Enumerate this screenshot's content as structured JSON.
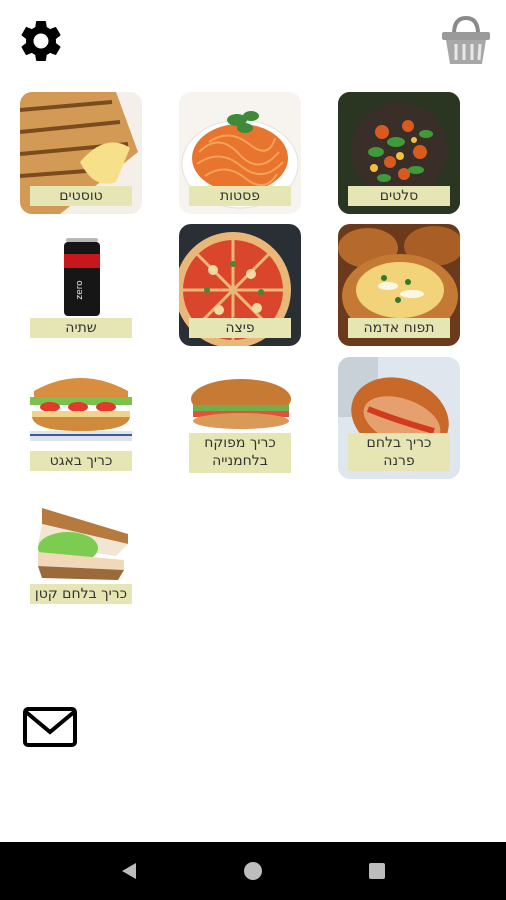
{
  "colors": {
    "label_bg": "#e6e6b4",
    "nav_bg": "#000000",
    "icon": "#000000"
  },
  "icons": {
    "settings": "gear-icon",
    "cart": "shopping-basket-icon",
    "mail": "mail-icon"
  },
  "categories": [
    {
      "id": "salads",
      "label": "סלטים"
    },
    {
      "id": "pastas",
      "label": "פסטות"
    },
    {
      "id": "toasts",
      "label": "טוסטים"
    },
    {
      "id": "potato",
      "label": "תפוח אדמה"
    },
    {
      "id": "pizza",
      "label": "פיצה"
    },
    {
      "id": "drink",
      "label": "שתיה"
    },
    {
      "id": "frena",
      "label": "כריך בלחם פרנה"
    },
    {
      "id": "ciabatta",
      "label": "כריך מפוקח בלחמנייה"
    },
    {
      "id": "baguette",
      "label": "כריך באגט"
    },
    {
      "id": "small",
      "label": "כריך בלחם קטן"
    }
  ],
  "navbar": {
    "back": "back-icon",
    "home": "home-icon",
    "recents": "recents-icon"
  }
}
